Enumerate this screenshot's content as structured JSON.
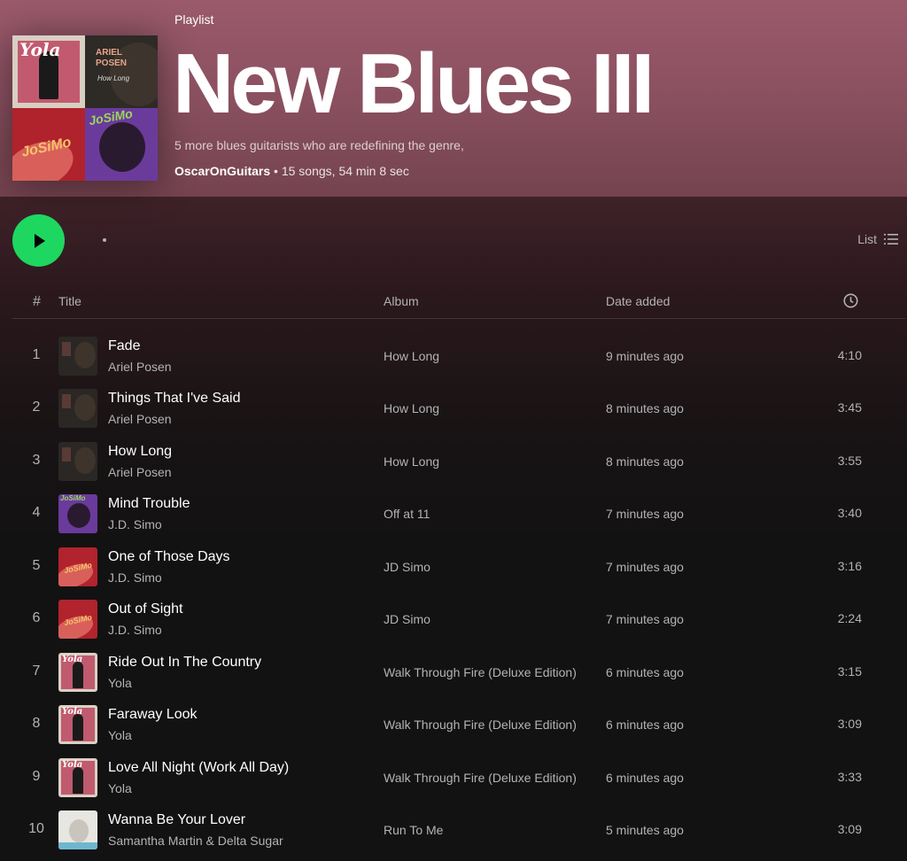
{
  "playlist": {
    "type_label": "Playlist",
    "title": "New Blues III",
    "description": "5 more blues guitarists who are redefining the genre,",
    "owner": "OscarOnGuitars",
    "separator": " • ",
    "stats": "15 songs, 54 min 8 sec",
    "cover": {
      "yola_text": "Yola",
      "ariel_text": "ARIEL POSEN",
      "ariel_sub": "How Long",
      "jd_text": "JoSiMo",
      "purple_text": "JoSiMo"
    }
  },
  "actionbar": {
    "play_icon": "play-icon",
    "more_icon": "more-options-icon",
    "view_label": "List",
    "view_icon": "list-view-icon",
    "accent_color": "#1ed760"
  },
  "columns": {
    "number": "#",
    "title": "Title",
    "album": "Album",
    "date_added": "Date added",
    "duration_icon": "clock-icon"
  },
  "tracks": [
    {
      "number": "1",
      "title": "Fade",
      "artist": "Ariel Posen",
      "album": "How Long",
      "date_added": "9 minutes ago",
      "duration": "4:10",
      "art": "ariel"
    },
    {
      "number": "2",
      "title": "Things That I've Said",
      "artist": "Ariel Posen",
      "album": "How Long",
      "date_added": "8 minutes ago",
      "duration": "3:45",
      "art": "ariel"
    },
    {
      "number": "3",
      "title": "How Long",
      "artist": "Ariel Posen",
      "album": "How Long",
      "date_added": "8 minutes ago",
      "duration": "3:55",
      "art": "ariel"
    },
    {
      "number": "4",
      "title": "Mind Trouble",
      "artist": "J.D. Simo",
      "album": "Off at 11",
      "date_added": "7 minutes ago",
      "duration": "3:40",
      "art": "mind"
    },
    {
      "number": "5",
      "title": "One of Those Days",
      "artist": "J.D. Simo",
      "album": "JD Simo",
      "date_added": "7 minutes ago",
      "duration": "3:16",
      "art": "jd"
    },
    {
      "number": "6",
      "title": "Out of Sight",
      "artist": "J.D. Simo",
      "album": "JD Simo",
      "date_added": "7 minutes ago",
      "duration": "2:24",
      "art": "jd"
    },
    {
      "number": "7",
      "title": "Ride Out In The Country",
      "artist": "Yola",
      "album": "Walk Through Fire (Deluxe Edition)",
      "date_added": "6 minutes ago",
      "duration": "3:15",
      "art": "yola"
    },
    {
      "number": "8",
      "title": "Faraway Look",
      "artist": "Yola",
      "album": "Walk Through Fire (Deluxe Edition)",
      "date_added": "6 minutes ago",
      "duration": "3:09",
      "art": "yola"
    },
    {
      "number": "9",
      "title": "Love All Night (Work All Day)",
      "artist": "Yola",
      "album": "Walk Through Fire (Deluxe Edition)",
      "date_added": "6 minutes ago",
      "duration": "3:33",
      "art": "yola"
    },
    {
      "number": "10",
      "title": "Wanna Be Your Lover",
      "artist": "Samantha Martin & Delta Sugar",
      "album": "Run To Me",
      "date_added": "5 minutes ago",
      "duration": "3:09",
      "art": "run"
    }
  ]
}
